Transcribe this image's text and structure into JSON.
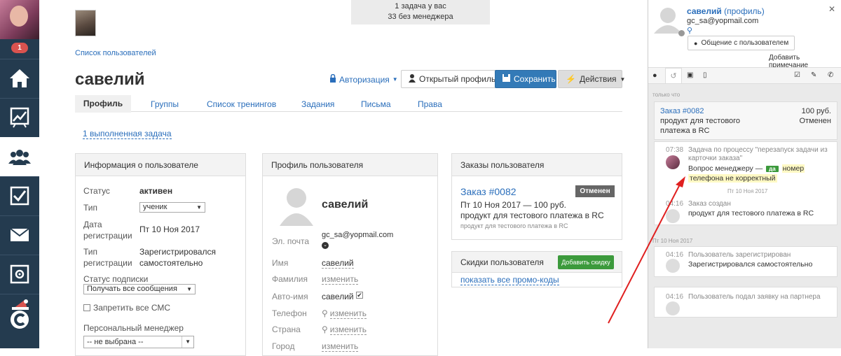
{
  "nav": {
    "badge_count": "1",
    "items": [
      "home-icon",
      "chart-icon",
      "users-icon",
      "checkbox-icon",
      "mail-icon",
      "settings-icon",
      "logo-icon"
    ]
  },
  "header": {
    "tasks_line1": "1 задача у вас",
    "tasks_line2": "33 без менеджера"
  },
  "breadcrumb": "Список пользователей",
  "user": {
    "name": "савелий"
  },
  "toolbar": {
    "auth": "Авторизация",
    "open_profile": "Открытый профиль",
    "save": "Сохранить",
    "actions": "Действия"
  },
  "tabs": [
    "Профиль",
    "Группы",
    "Список тренингов",
    "Задания",
    "Письма",
    "Права"
  ],
  "completed_link": "1 выполненная задача",
  "info": {
    "title": "Информация о пользователе",
    "status_label": "Статус",
    "status_value": "активен",
    "type_label": "Тип",
    "type_value": "ученик",
    "regdate_label1": "Дата",
    "regdate_label2": "регистрации",
    "regdate_value": "Пт 10 Ноя 2017",
    "regtype_label1": "Тип",
    "regtype_label2": "регистрации",
    "regtype_value1": "Зарегистрировался",
    "regtype_value2": "самостоятельно",
    "sub_label": "Статус подписки",
    "sub_value": "Получать все сообщения",
    "sms_label": "Запретить все СМС",
    "manager_label": "Персональный менеджер",
    "manager_value": "-- не выбрана --"
  },
  "profile": {
    "title": "Профиль пользователя",
    "name": "савелий",
    "email_label": "Эл. почта",
    "email_value": "gc_sa@yopmail.com",
    "name_label": "Имя",
    "name_value": "савелий",
    "surname_label": "Фамилия",
    "change": "изменить",
    "autoname_label": "Авто-имя",
    "autoname_value": "савелий",
    "phone_label": "Телефон",
    "country_label": "Страна",
    "city_label": "Город"
  },
  "orders": {
    "title": "Заказы пользователя",
    "order_link": "Заказ #0082",
    "status": "Отменен",
    "line1": "Пт 10 Ноя 2017 — 100 руб.",
    "line2": "продукт для тестового платежа в RC",
    "line3": "продукт для тестового платежа в RC"
  },
  "discounts": {
    "title": "Скидки пользователя",
    "add": "Добавить скидку",
    "promo": "показать все промо-коды"
  },
  "side": {
    "name": "савелий",
    "profile_link": "(профиль)",
    "email": "gc_sa@yopmail.com",
    "chat_btn": "Общение с пользователем",
    "add_note": "Добавить примечание",
    "just_now": "только что",
    "order_link": "Заказ #0082",
    "order_price": "100 руб.",
    "order_desc1": "продукт для тестового",
    "order_desc2": "платежа в RC",
    "order_status": "Отменен",
    "ev1_time": "07:38",
    "ev1_title1": "Задача по процессу \"перезапуск задачи из",
    "ev1_title2": "карточки заказа\"",
    "ev1_q": "Вопрос менеджеру —",
    "ev1_yes": "да",
    "ev1_ans1": "номер",
    "ev1_ans2": "телефона не корректный",
    "ev1_date": "Пт 10 Ноя 2017",
    "ev2_time": "04:16",
    "ev2_title": "Заказ создан",
    "ev2_desc": "продукт для тестового платежа в RC",
    "date2": "Пт 10 Ноя 2017",
    "ev3_time": "04:16",
    "ev3_title": "Пользователь зарегистрирован",
    "ev3_desc": "Зарегистрировался самостоятельно",
    "ev4_time": "04:16",
    "ev4_title": "Пользователь подал заявку на партнера"
  },
  "colors": {
    "nav_bg": "#243b4f",
    "primary": "#337ab7",
    "success": "#3c9a3c",
    "danger": "#d9534f",
    "arrow": "#e02020"
  }
}
